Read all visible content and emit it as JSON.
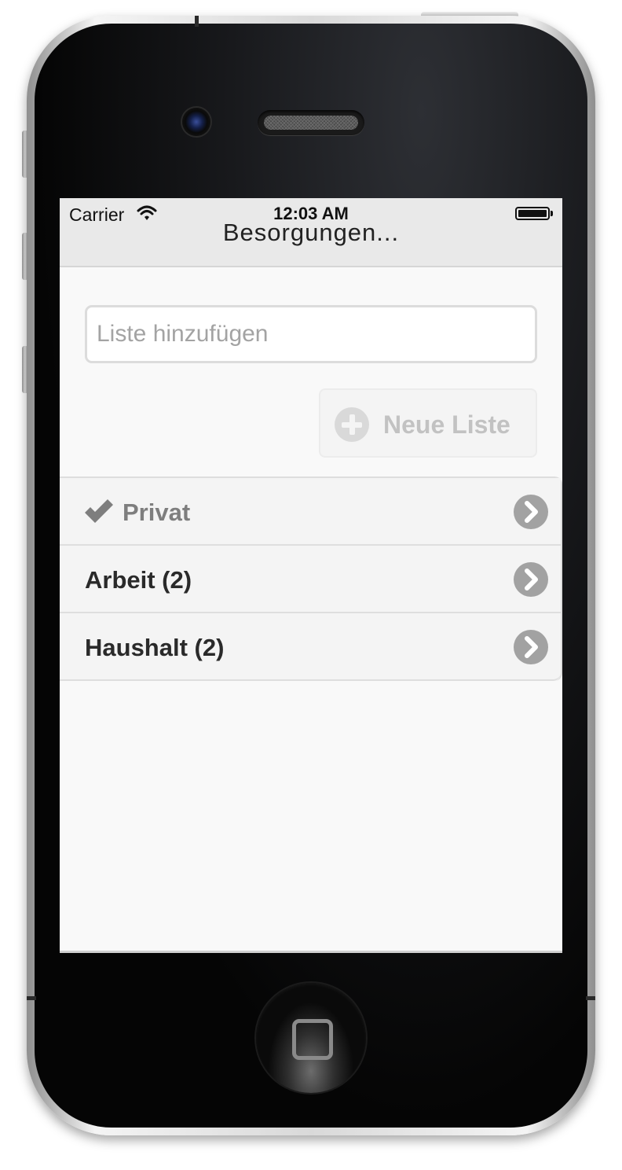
{
  "status_bar": {
    "carrier": "Carrier",
    "time": "12:03 AM",
    "wifi_icon": "wifi-icon",
    "battery_icon": "battery-icon"
  },
  "nav": {
    "title": "Besorgungen..."
  },
  "add_list": {
    "placeholder": "Liste hinzufügen",
    "value": "",
    "button_label": "Neue Liste",
    "button_icon": "plus-circle-icon"
  },
  "lists": [
    {
      "label": "Privat",
      "selected": true,
      "icon": "checkmark-icon"
    },
    {
      "label": "Arbeit (2)",
      "selected": false
    },
    {
      "label": "Haushalt (2)",
      "selected": false
    }
  ],
  "colors": {
    "screen_bg": "#f9f9f9",
    "nav_bg": "#e9e9e9",
    "row_bg": "#f4f4f4",
    "chevron": "#a2a2a2",
    "disabled_text": "#c2c2c2"
  }
}
